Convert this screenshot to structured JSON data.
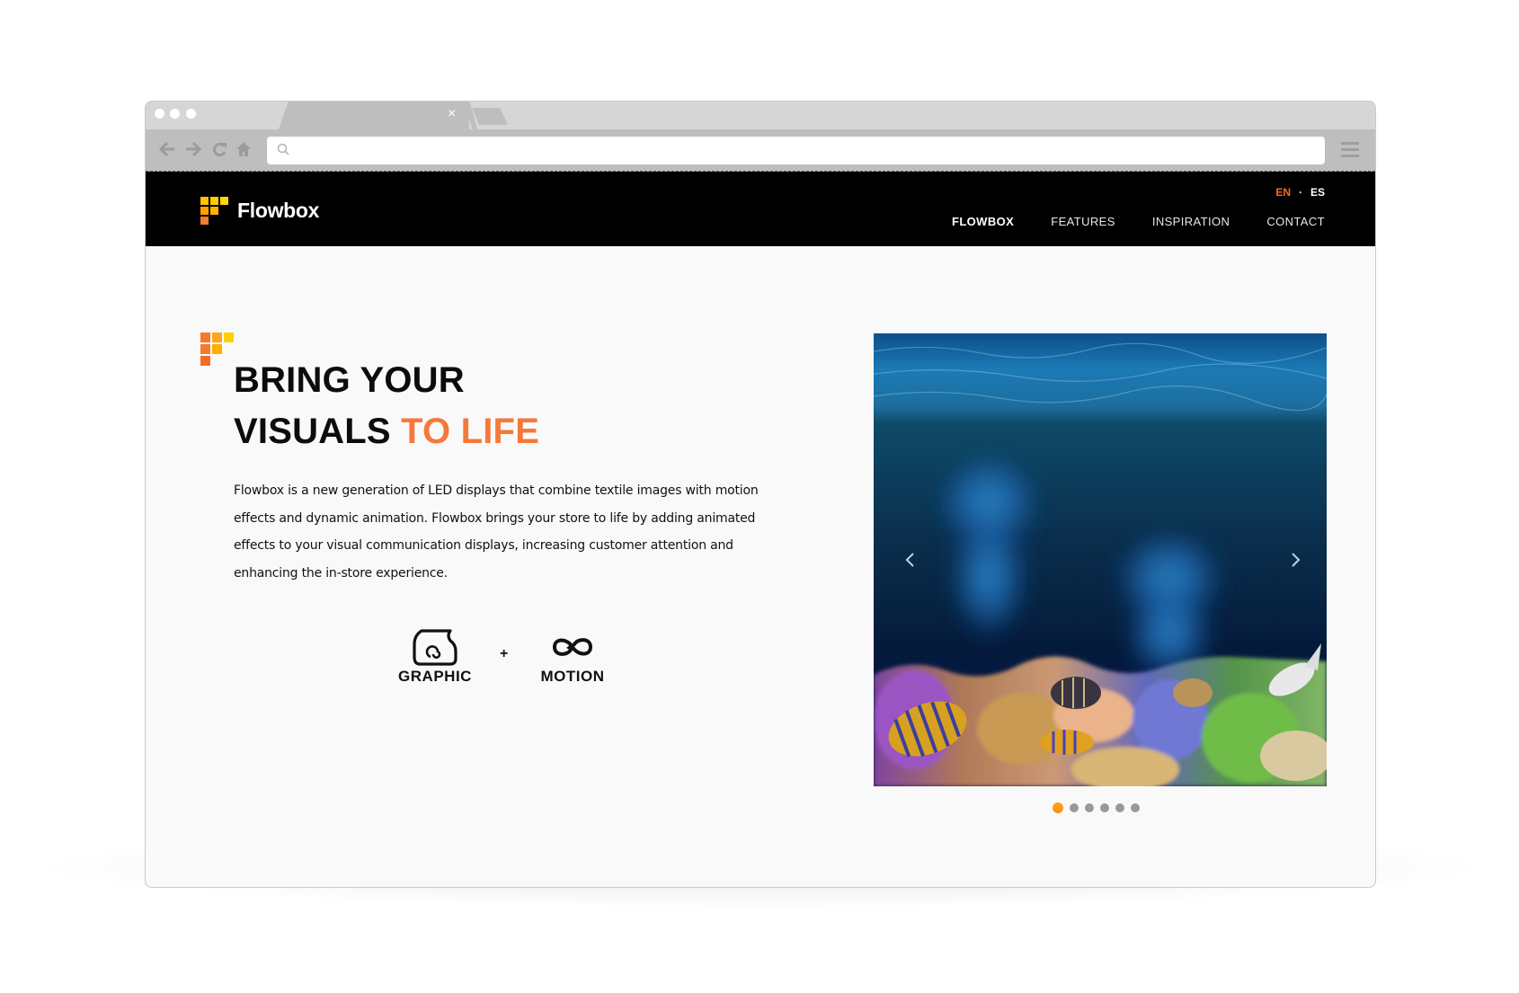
{
  "browser": {
    "tab_close_glyph": "×",
    "nav": {
      "back_glyph": "←",
      "forward_glyph": "→",
      "reload_glyph": "C",
      "home_glyph": "⌂"
    },
    "address": {
      "value": "",
      "placeholder": ""
    },
    "icons": [
      "search-icon",
      "menu-icon",
      "back-icon",
      "forward-icon",
      "reload-icon",
      "home-icon",
      "close-icon"
    ]
  },
  "site": {
    "logo_text": "Flowbox",
    "languages": {
      "active": "EN",
      "separator": "·",
      "other": "ES"
    },
    "nav": [
      {
        "label": "FLOWBOX",
        "active": true
      },
      {
        "label": "FEATURES",
        "active": false
      },
      {
        "label": "INSPIRATION",
        "active": false
      },
      {
        "label": "CONTACT",
        "active": false
      }
    ],
    "brand_colors": {
      "orange": "#f6783a",
      "yellow": "#ffcc00",
      "header_bg": "#000000",
      "dot_active": "#ff9a17",
      "dot_inactive": "#999999"
    }
  },
  "hero": {
    "title_line1": "BRING YOUR",
    "title_line2_plain": "VISUALS ",
    "title_line2_accent": "TO LIFE",
    "body": "Flowbox is a new generation of LED displays that combine textile images with motion effects and dynamic animation. Flowbox brings your store to life by adding animated effects to your visual communication displays, increasing customer attention and enhancing the in-store experience.",
    "features": [
      {
        "label": "GRAPHIC",
        "icon": "textile-roll-icon"
      },
      {
        "label": "MOTION",
        "icon": "infinity-loop-icon"
      }
    ],
    "plus": "+"
  },
  "slider": {
    "slide_description": "Underwater scene with jellyfish and coral reef fish",
    "prev_glyph": "‹",
    "next_glyph": "›",
    "total_slides": 6,
    "active_index": 0
  }
}
